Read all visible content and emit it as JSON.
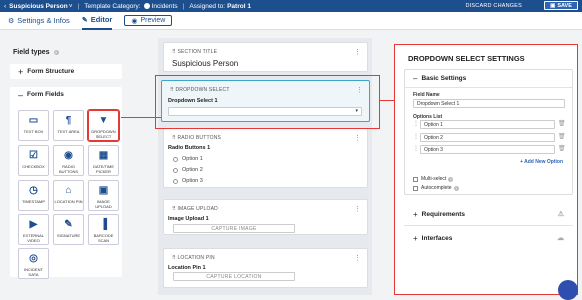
{
  "topbar": {
    "title": "Suspicious Person",
    "title_suffix": "˅",
    "template_label": "Template Category:",
    "template_value": "Incidents",
    "assigned_label": "Assigned to:",
    "assigned_value": "Patrol 1",
    "discard": "DISCARD CHANGES",
    "save": "SAVE"
  },
  "tabs": {
    "settings": "Settings & Infos",
    "editor": "Editor",
    "preview": "Preview"
  },
  "left": {
    "title": "Field types",
    "form_structure": "Form Structure",
    "form_fields": "Form Fields",
    "fields": [
      {
        "label": "TEXT BOX",
        "icon": "▭"
      },
      {
        "label": "TEXT AREA",
        "icon": "¶"
      },
      {
        "label": "DROPDOWN SELECT",
        "icon": "▼"
      },
      {
        "label": "CHECKBOX",
        "icon": "☑"
      },
      {
        "label": "RADIO BUTTONS",
        "icon": "◉"
      },
      {
        "label": "DATE/TIME PICKER",
        "icon": "▦"
      },
      {
        "label": "TIMESTAMP",
        "icon": "◷"
      },
      {
        "label": "LOCATION PIN",
        "icon": "⌂"
      },
      {
        "label": "IMAGE UPLOAD",
        "icon": "▣"
      },
      {
        "label": "EXTERNAL VIDEO",
        "icon": "▶"
      },
      {
        "label": "SIGNATURE",
        "icon": "✎"
      },
      {
        "label": "BARCODE SCAN",
        "icon": "▐"
      },
      {
        "label": "INCIDENT DATA",
        "icon": "◎"
      }
    ]
  },
  "canvas": {
    "section_title_label": "SECTION TITLE",
    "section_title_value": "Suspicious Person",
    "dropdown_label": "DROPDOWN SELECT",
    "dropdown_field": "Dropdown Select 1",
    "radio_label": "RADIO BUTTONS",
    "radio_field": "Radio Buttons 1",
    "radio_options": [
      "Option 1",
      "Option 2",
      "Option 3"
    ],
    "image_label": "IMAGE UPLOAD",
    "image_field": "Image Upload 1",
    "image_button": "CAPTURE IMAGE",
    "location_label": "LOCATION PIN",
    "location_field": "Location Pin 1",
    "location_button": "CAPTURE LOCATION"
  },
  "settings": {
    "title": "DROPDOWN SELECT SETTINGS",
    "basic": "Basic Settings",
    "field_name_label": "Field Name",
    "field_name_value": "Dropdown Select 1",
    "options_label": "Options List",
    "options": [
      "Option 1",
      "Option 2",
      "Option 3"
    ],
    "add_option": "+ Add New Option",
    "multi_select": "Multi-select",
    "autocomplete": "Autocomplete",
    "requirements": "Requirements",
    "interfaces": "Interfaces"
  },
  "colors": {
    "brand": "#1d4f8f",
    "highlight": "#e53935"
  }
}
